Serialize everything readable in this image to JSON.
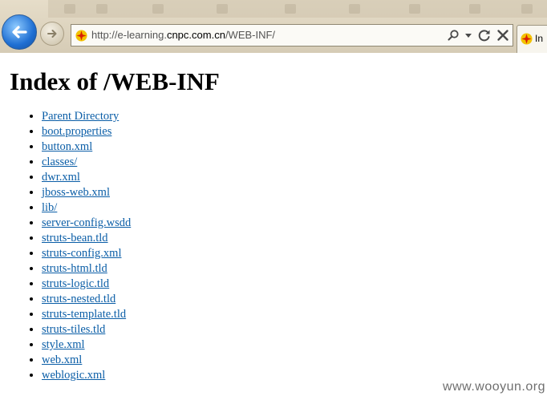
{
  "browser": {
    "url_prefix": "http://e-learning.",
    "url_host": "cnpc.com.cn",
    "url_path": "/WEB-INF/",
    "tab_label": "In"
  },
  "page": {
    "title": "Index of /WEB-INF",
    "entries": [
      {
        "label": "Parent Directory"
      },
      {
        "label": "boot.properties"
      },
      {
        "label": "button.xml"
      },
      {
        "label": "classes/"
      },
      {
        "label": "dwr.xml"
      },
      {
        "label": "jboss-web.xml"
      },
      {
        "label": "lib/"
      },
      {
        "label": "server-config.wsdd"
      },
      {
        "label": "struts-bean.tld"
      },
      {
        "label": "struts-config.xml"
      },
      {
        "label": "struts-html.tld"
      },
      {
        "label": "struts-logic.tld"
      },
      {
        "label": "struts-nested.tld"
      },
      {
        "label": "struts-template.tld"
      },
      {
        "label": "struts-tiles.tld"
      },
      {
        "label": "style.xml"
      },
      {
        "label": "web.xml"
      },
      {
        "label": "weblogic.xml"
      }
    ]
  },
  "watermark": "www.wooyun.org",
  "colors": {
    "link": "#0b5ea7",
    "chrome": "#ddd3bf",
    "back_button": "#1f6fd3"
  },
  "icons": {
    "back": "back-arrow-icon",
    "forward": "forward-arrow-icon",
    "site": "cnpc-logo-icon",
    "search": "search-icon",
    "dropdown": "chevron-down-icon",
    "refresh": "refresh-icon",
    "stop": "close-icon"
  }
}
